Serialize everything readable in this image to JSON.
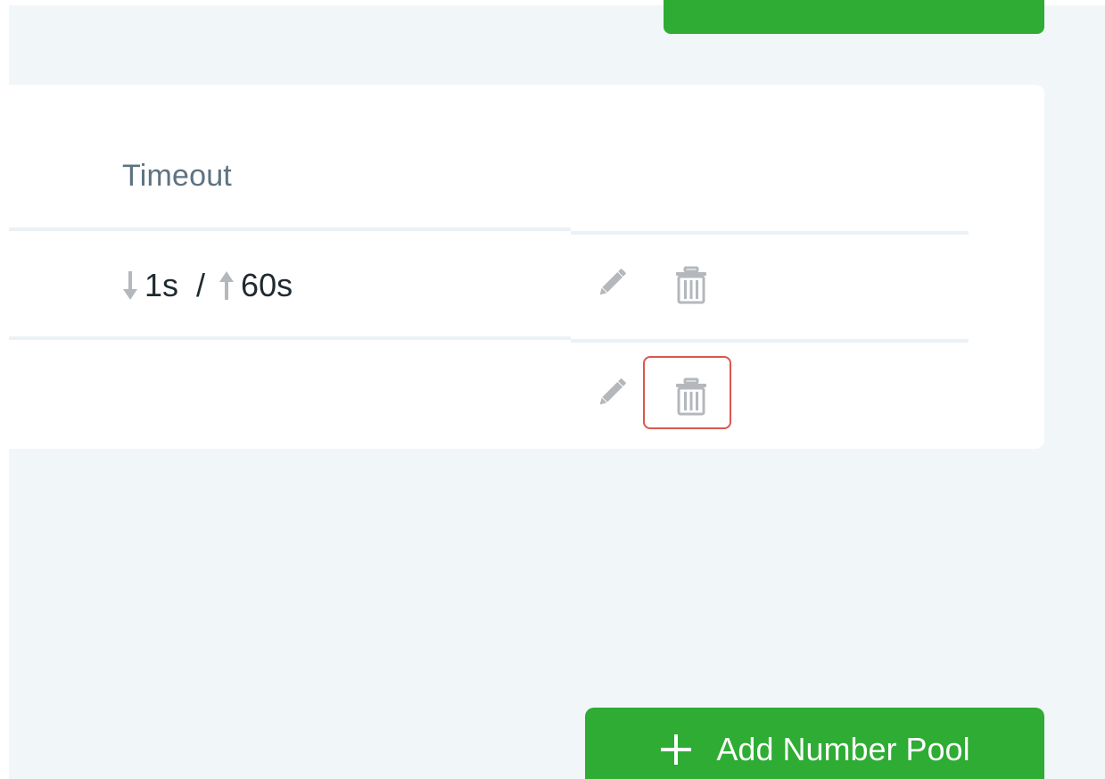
{
  "table": {
    "columns": {
      "timeout": "Timeout"
    },
    "rows": [
      {
        "timeout_down": "1s",
        "timeout_separator": "/",
        "timeout_up": "60s"
      },
      {
        "timeout_down": "",
        "timeout_separator": "",
        "timeout_up": ""
      }
    ]
  },
  "actions": {
    "add_number_pool_label": "Add Number Pool"
  },
  "icons": {
    "edit": "pencil-icon",
    "delete": "trash-icon",
    "arrow_down": "arrow-down-icon",
    "arrow_up": "arrow-up-icon",
    "add": "plus-icon"
  },
  "colors": {
    "primary_green": "#2eac34",
    "highlight_red": "#d9574c",
    "icon_gray": "#b4b8bc",
    "header_text": "#5d7381",
    "background": "#f1f6f9"
  }
}
